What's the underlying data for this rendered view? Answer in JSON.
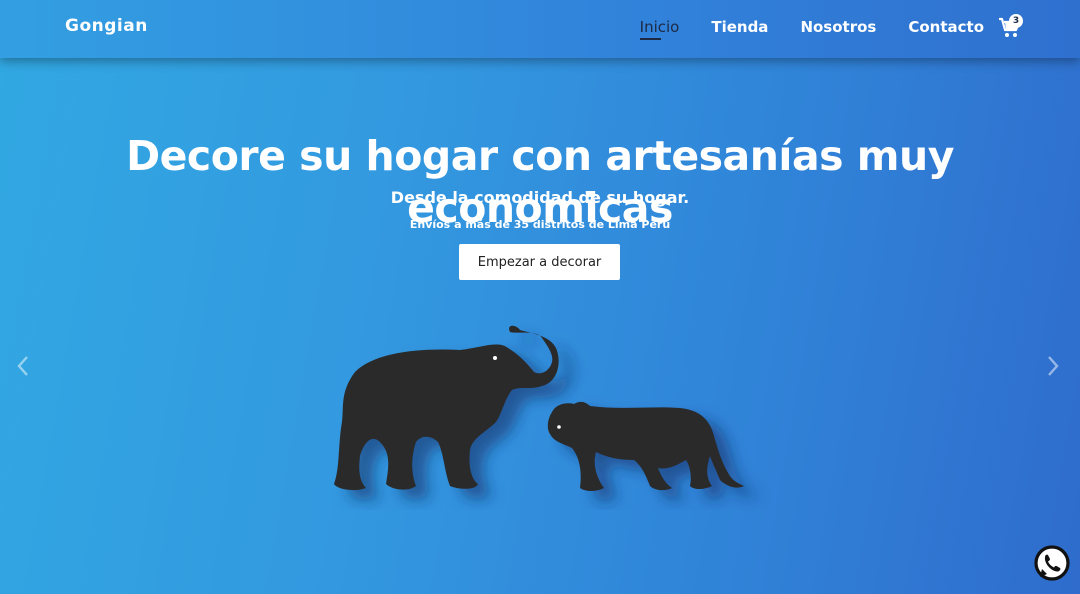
{
  "navbar": {
    "logo": "Gongian",
    "links": [
      "Inicio",
      "Tienda",
      "Nosotros",
      "Contacto"
    ],
    "active_link": "Inicio",
    "cart_icon": "shopping-cart-icon",
    "cart_count": "3"
  },
  "hero": {
    "title": "Decore su hogar con artesanías muy economicas",
    "subtitle": "Desde la comodidad de su hogar.",
    "note": "Envíos a más de 35 distritos de Lima Perú",
    "cta_label": "Empezar a decorar"
  },
  "carousel": {
    "prev_icon": "chevron-left-icon",
    "next_icon": "chevron-right-icon"
  },
  "whatsapp": {
    "icon": "whatsapp-icon"
  },
  "colors": {
    "background_start": "#31a8e2",
    "background_end": "#2f6ccc",
    "silhouette": "#2a2a2a",
    "button_bg": "#ffffff",
    "active_link": "#1d2a44"
  }
}
